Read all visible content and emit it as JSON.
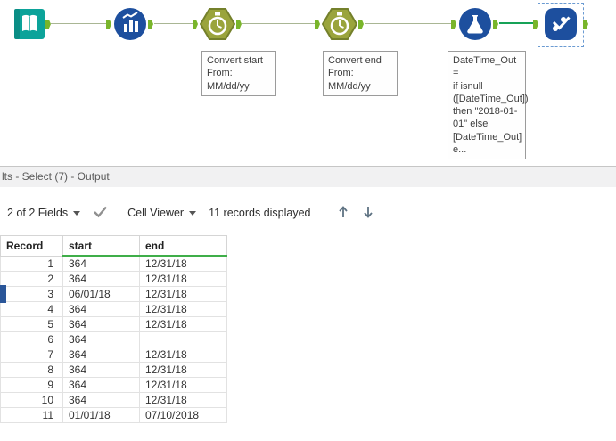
{
  "workflow": {
    "annotations": {
      "datetime_start": "Convert start\nFrom:\nMM/dd/yy",
      "datetime_end": "Convert end\nFrom:\nMM/dd/yy",
      "formula": "DateTime_Out =\nif isnull\n([DateTime_Out])\nthen \"2018-01-\n01\" else\n[DateTime_Out]\ne..."
    },
    "icons": {
      "tool_input": "book",
      "tool_prepare": "chart-bars",
      "tool_datetime": "stopwatch-hexagon",
      "tool_formula": "flask",
      "tool_select": "checkmarks"
    }
  },
  "results": {
    "pane_title": "lts - Select (7) - Output",
    "toolbar": {
      "fields_dropdown": "2 of 2 Fields",
      "cell_viewer_dropdown": "Cell Viewer",
      "records_displayed": "11 records displayed"
    },
    "table": {
      "columns": [
        "Record",
        "start",
        "end"
      ],
      "rows": [
        [
          "1",
          "364",
          "12/31/18"
        ],
        [
          "2",
          "364",
          "12/31/18"
        ],
        [
          "3",
          "06/01/18",
          "12/31/18"
        ],
        [
          "4",
          "364",
          "12/31/18"
        ],
        [
          "5",
          "364",
          "12/31/18"
        ],
        [
          "6",
          "364",
          ""
        ],
        [
          "7",
          "364",
          "12/31/18"
        ],
        [
          "8",
          "364",
          "12/31/18"
        ],
        [
          "9",
          "364",
          "12/31/18"
        ],
        [
          "10",
          "364",
          "12/31/18"
        ],
        [
          "11",
          "01/01/18",
          "07/10/2018"
        ]
      ]
    }
  },
  "colors": {
    "accent_green": "#17a257",
    "anchor_green": "#79b52b",
    "tool_blue": "#1d4f9e",
    "tool_olive": "#9aa43c",
    "input_teal": "#0ca39a"
  }
}
